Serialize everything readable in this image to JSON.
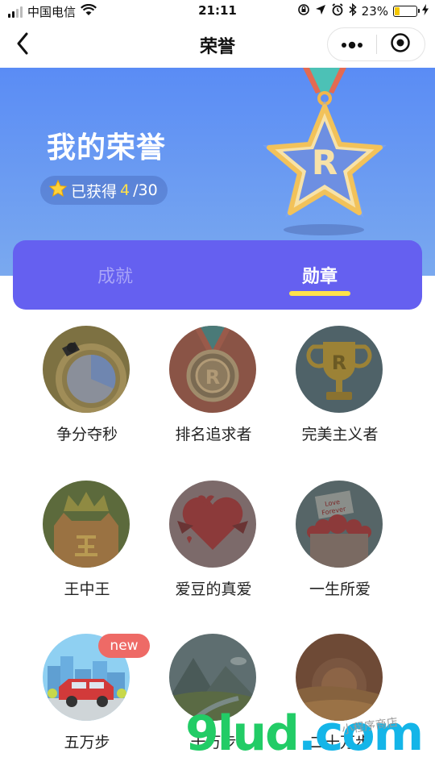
{
  "status_bar": {
    "carrier": "中国电信",
    "time": "21:11",
    "battery_percent": "23%",
    "battery_level": 0.23,
    "icons": [
      "signal-icon",
      "wifi-icon",
      "rotation-lock-icon",
      "location-icon",
      "alarm-icon",
      "bluetooth-icon",
      "battery-icon",
      "charging-icon"
    ]
  },
  "nav": {
    "title": "荣誉",
    "back_icon": "chevron-left-icon",
    "more_icon": "more-dots-icon",
    "close_icon": "target-close-icon"
  },
  "hero": {
    "title": "我的荣誉",
    "earned_label": "已获得",
    "earned_count": "4",
    "earned_total": "/30",
    "star_icon": "star-icon",
    "medal_letter": "R"
  },
  "tabs": [
    {
      "label": "成就",
      "active": false
    },
    {
      "label": "勋章",
      "active": true
    }
  ],
  "badges": [
    {
      "label": "争分夺秒",
      "icon": "stopwatch-icon",
      "new": false
    },
    {
      "label": "排名追求者",
      "icon": "medal-icon",
      "new": false
    },
    {
      "label": "完美主义者",
      "icon": "trophy-icon",
      "new": false
    },
    {
      "label": "王中王",
      "icon": "crown-cat-icon",
      "new": false
    },
    {
      "label": "爱豆的真爱",
      "icon": "heart-icon",
      "new": false
    },
    {
      "label": "一生所爱",
      "icon": "love-forever-icon",
      "new": false
    },
    {
      "label": "五万步",
      "icon": "car-city-icon",
      "new": true
    },
    {
      "label": "十万步",
      "icon": "mountain-icon",
      "new": false
    },
    {
      "label": "二十万步",
      "icon": "desert-sun-icon",
      "new": false
    }
  ],
  "new_badge_label": "new",
  "love_text_1": "Love",
  "love_text_2": "Forever",
  "watermark": {
    "brand": "9lud",
    "domain": ".com",
    "tagline": "小程序商店"
  },
  "colors": {
    "hero_gradient_top": "#5a8cf5",
    "tab_card": "#6560f0",
    "tab_accent": "#ffe14a",
    "new_badge": "#ee6a66"
  }
}
